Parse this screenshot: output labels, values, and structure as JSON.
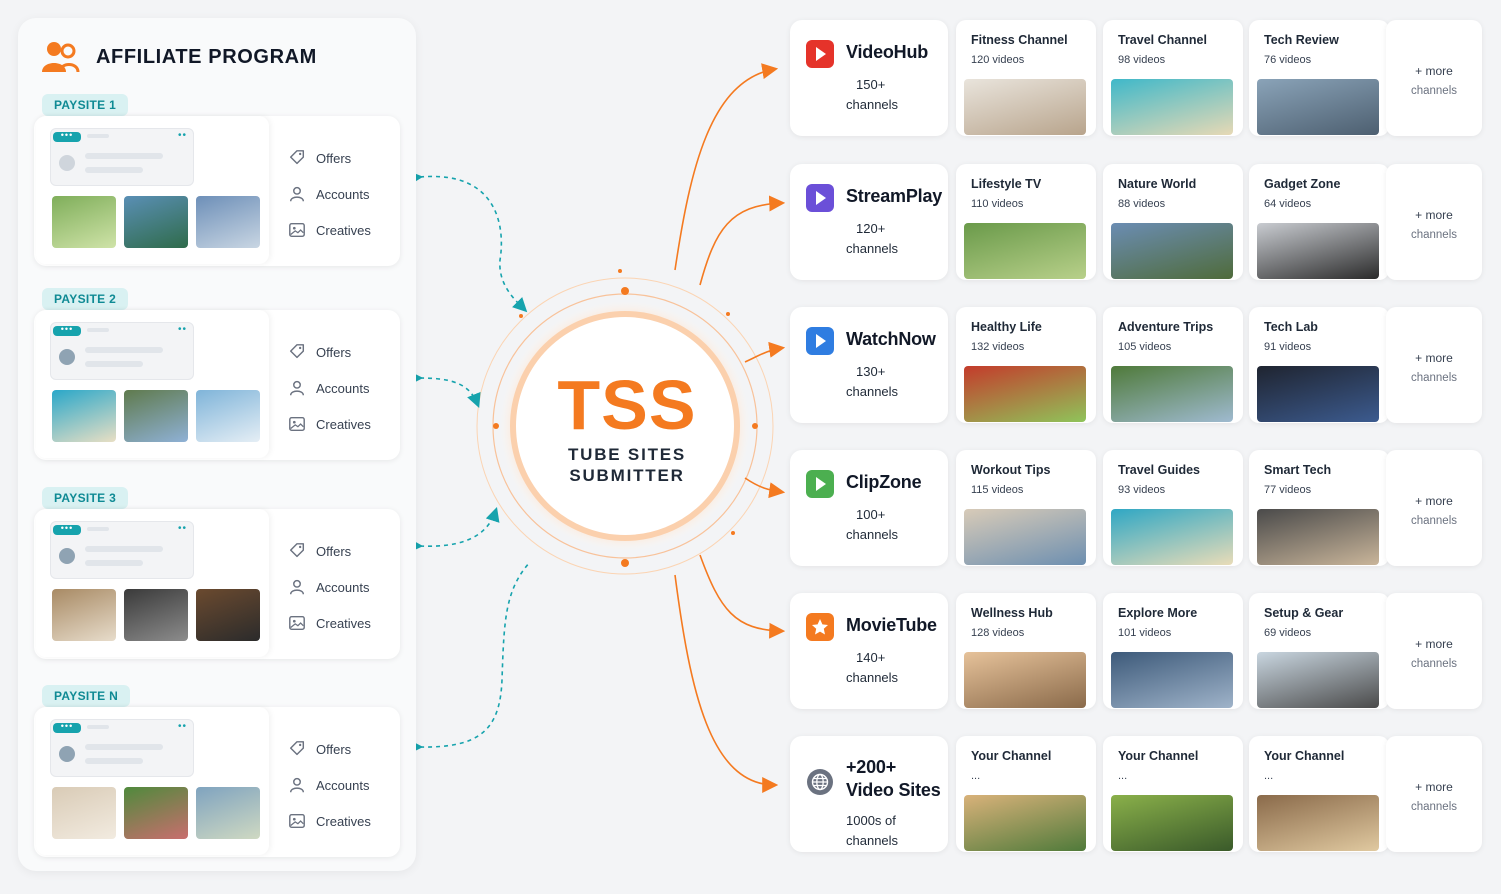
{
  "header": {
    "title": "AFFILIATE PROGRAM"
  },
  "link_labels": {
    "offers": "Offers",
    "accounts": "Accounts",
    "creatives": "Creatives"
  },
  "paysites": [
    {
      "tag": "PAYSITE 1"
    },
    {
      "tag": "PAYSITE 2"
    },
    {
      "tag": "PAYSITE 3"
    },
    {
      "tag": "PAYSITE N"
    }
  ],
  "hub": {
    "logo": "TSS",
    "line1": "TUBE SITES",
    "line2": "SUBMITTER"
  },
  "tube_sites": [
    {
      "name": "VideoHub",
      "count": "150+",
      "unit": "channels",
      "icon": "play-icon",
      "color": "#e5332a",
      "channels": [
        {
          "name": "Fitness Channel",
          "videos": "120 videos"
        },
        {
          "name": "Travel Channel",
          "videos": "98 videos"
        },
        {
          "name": "Tech Review",
          "videos": "76 videos"
        }
      ]
    },
    {
      "name": "StreamPlay",
      "count": "120+",
      "unit": "channels",
      "icon": "play-icon",
      "color": "#6b4fd8",
      "channels": [
        {
          "name": "Lifestyle TV",
          "videos": "110 videos"
        },
        {
          "name": "Nature World",
          "videos": "88 videos"
        },
        {
          "name": "Gadget Zone",
          "videos": "64 videos"
        }
      ]
    },
    {
      "name": "WatchNow",
      "count": "130+",
      "unit": "channels",
      "icon": "play-icon",
      "color": "#2f7de1",
      "channels": [
        {
          "name": "Healthy Life",
          "videos": "132 videos"
        },
        {
          "name": "Adventure Trips",
          "videos": "105 videos"
        },
        {
          "name": "Tech Lab",
          "videos": "91 videos"
        }
      ]
    },
    {
      "name": "ClipZone",
      "count": "100+",
      "unit": "channels",
      "icon": "play-icon",
      "color": "#4caf50",
      "channels": [
        {
          "name": "Workout Tips",
          "videos": "115 videos"
        },
        {
          "name": "Travel Guides",
          "videos": "93 videos"
        },
        {
          "name": "Smart Tech",
          "videos": "77 videos"
        }
      ]
    },
    {
      "name": "MovieTube",
      "count": "140+",
      "unit": "channels",
      "icon": "star-icon",
      "color": "#f47a20",
      "channels": [
        {
          "name": "Wellness Hub",
          "videos": "128 videos"
        },
        {
          "name": "Explore More",
          "videos": "101 videos"
        },
        {
          "name": "Setup & Gear",
          "videos": "69 videos"
        }
      ]
    },
    {
      "name_line1": "+200+",
      "name_line2": "Video Sites",
      "count": "1000s of",
      "unit": "channels",
      "icon": "globe-icon",
      "color": "#6b7280",
      "channels": [
        {
          "name": "Your Channel",
          "videos": "..."
        },
        {
          "name": "Your Channel",
          "videos": "..."
        },
        {
          "name": "Your Channel",
          "videos": "..."
        }
      ]
    }
  ],
  "more": {
    "line1": "+ more",
    "line2": "channels"
  },
  "colors": {
    "accent": "#f47a20",
    "teal": "#16a3ad"
  }
}
